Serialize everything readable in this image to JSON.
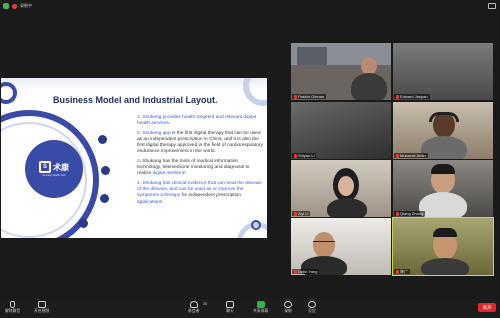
{
  "topbar": {
    "recording_label": "录制中"
  },
  "slide": {
    "title": "Business Model and Industrial Layout.",
    "logo_text": "术康",
    "logo_sub": "Shukang Health Tech",
    "points": [
      {
        "prefix": "1. ",
        "text": "Shukang provides health-targeted and relevant ",
        "highlight": "digital health",
        "suffix": " services."
      },
      {
        "prefix": "2. ",
        "highlight_lead": "Shukang app",
        "text": " is the first digital therapy that can be used as an independent prescription in China, and it is also the first digital therapy approved in the field of cardiorespiratory endurance improvement in the world."
      },
      {
        "prefix": "3. ",
        "text": "Shukang has the tools of medical information technology, telemedicine monitoring and diagnosis to realize ",
        "highlight": "digital medicine",
        "suffix": "."
      },
      {
        "prefix": "4. ",
        "text": "Shukang has clinical evidence that can treat the disease of the disease, and can be used ",
        "highlight": "as",
        "suffix": " or improve the symptoms a ",
        "highlight2": "therapy",
        "suffix2": " for independent prescription ",
        "highlight3": "applications",
        "suffix3": "."
      }
    ]
  },
  "participants": [
    {
      "name": "Pakkin Ginnan"
    },
    {
      "name": "Edward Jaspan"
    },
    {
      "name": "Shiyao Li"
    },
    {
      "name": "Mubarak Amin"
    },
    {
      "name": "Ziyi Li"
    },
    {
      "name": "Qiang Zhong"
    },
    {
      "name": "Linlin Yang"
    },
    {
      "name": "林广"
    }
  ],
  "toolbar": {
    "mute": "解除静音",
    "video": "开启视频",
    "participants": "参会者",
    "participants_count": "25",
    "chat": "聊天",
    "share": "共享屏幕",
    "record": "录制",
    "reactions": "反应",
    "leave": "离开"
  },
  "colors": {
    "accent": "#3a4aa7",
    "highlight": "#3a5bcf",
    "leave": "#e02828"
  }
}
